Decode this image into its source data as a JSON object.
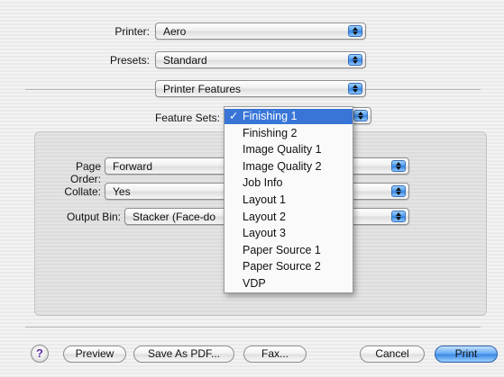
{
  "printer": {
    "label": "Printer:",
    "value": "Aero"
  },
  "presets": {
    "label": "Presets:",
    "value": "Standard"
  },
  "panel": {
    "value": "Printer Features"
  },
  "feature_sets": {
    "label": "Feature Sets:",
    "menu": [
      {
        "label": "Finishing 1",
        "checked": true
      },
      {
        "label": "Finishing 2"
      },
      {
        "label": "Image Quality 1"
      },
      {
        "label": "Image Quality 2"
      },
      {
        "label": "Job Info"
      },
      {
        "label": "Layout 1"
      },
      {
        "label": "Layout 2"
      },
      {
        "label": "Layout 3"
      },
      {
        "label": "Paper Source 1"
      },
      {
        "label": "Paper Source 2"
      },
      {
        "label": "VDP"
      }
    ],
    "check_glyph": "✓"
  },
  "options": {
    "page_order": {
      "label": "Page Order:",
      "value": "Forward"
    },
    "collate": {
      "label": "Collate:",
      "value": "Yes"
    },
    "output_bin": {
      "label": "Output Bin:",
      "value": "Stacker (Face-do"
    }
  },
  "buttons": {
    "help": "?",
    "preview": "Preview",
    "save_pdf": "Save As PDF...",
    "fax": "Fax...",
    "cancel": "Cancel",
    "print": "Print"
  },
  "colors": {
    "selection": "#3875d7",
    "accent": "#4a98ee"
  },
  "icons": {
    "popup": "popup-arrows-icon",
    "help": "help-icon"
  }
}
